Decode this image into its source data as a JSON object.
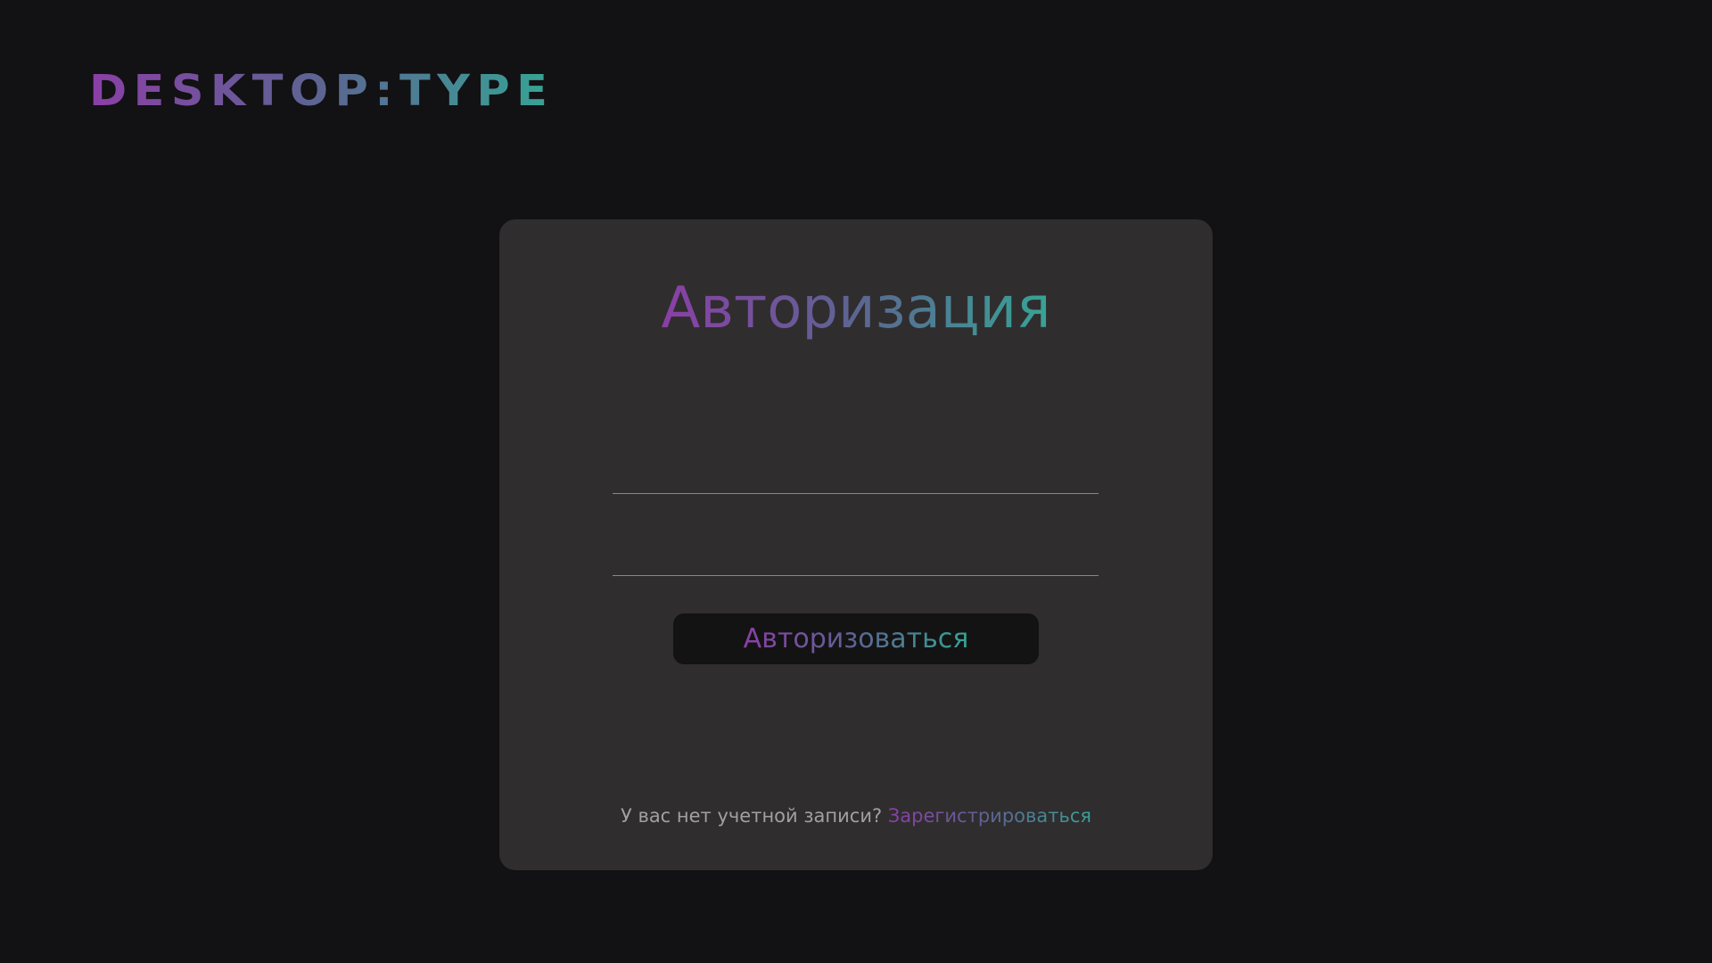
{
  "app": {
    "logo_text": "DESKTOP:TYPE"
  },
  "auth": {
    "title": "Авторизация",
    "fields": {
      "login_value": "",
      "login_placeholder": "",
      "password_value": "",
      "password_placeholder": ""
    },
    "submit_label": "Авторизоваться",
    "footer": {
      "question": "У вас нет учетной записи?",
      "register_link": "Зарегистрироваться"
    }
  },
  "colors": {
    "background": "#121113",
    "card": "#302d2e",
    "button": "#141314",
    "gradient_start": "#8a3fa6",
    "gradient_end": "#36a495",
    "muted_text": "#a19fa0",
    "field_line": "#8a8789"
  }
}
